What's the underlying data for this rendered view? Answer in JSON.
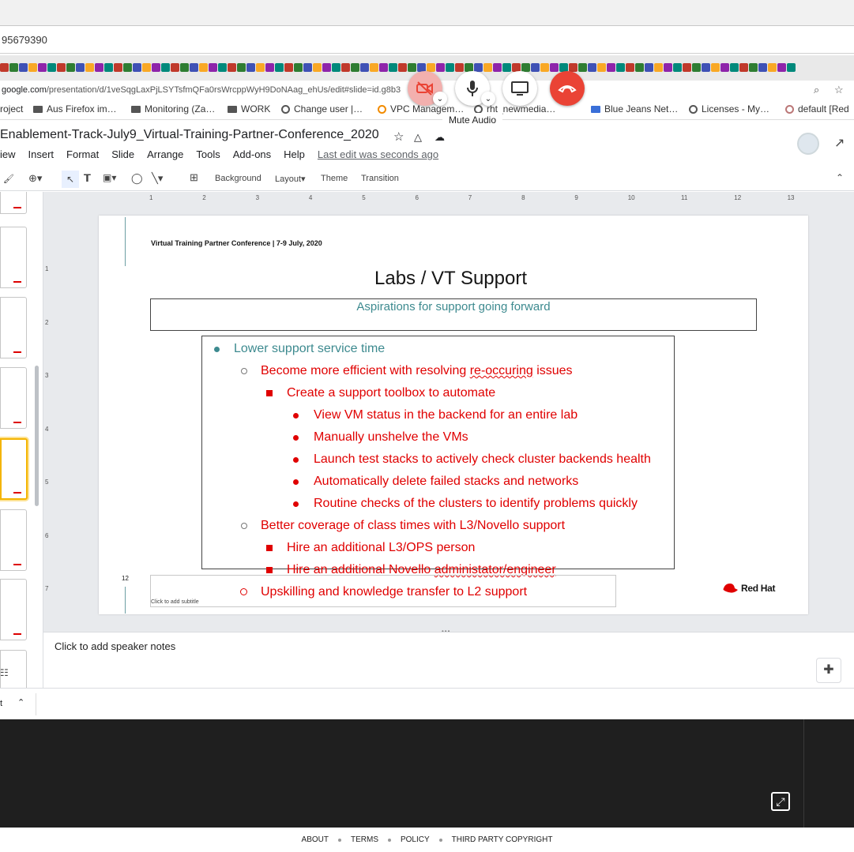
{
  "browser": {
    "url_fragment": "95679390",
    "address": "google.com/presentation/d/1veSqgLaxPjLSYTsfmQFa0rsWrcppWyH9DoNAag_ehUs/edit#slide=id.g8b3",
    "address_host": "google.com",
    "address_path": "/presentation/d/1veSqgLaxPjLSYTsfmQFa0rsWrcppWyH9DoNAag_ehUs/edit#slide=id.g8b3",
    "bookmarks": [
      "roject",
      "Aus Firefox im…",
      "Monitoring (Za…",
      "WORK",
      "Change user |…",
      "VPC Managem…",
      "rht_newmedia…",
      "Blue Jeans Net…",
      "Licenses - My…",
      "default [Red"
    ]
  },
  "call_controls": {
    "tooltip": "Mute Audio",
    "colors": {
      "video_off": "#ea4335",
      "end_call": "#ea4335"
    }
  },
  "docs": {
    "title": "Enablement-Track-July9_Virtual-Training-Partner-Conference_2020",
    "menu": [
      "iew",
      "Insert",
      "Format",
      "Slide",
      "Arrange",
      "Tools",
      "Add-ons",
      "Help"
    ],
    "last_edit": "Last edit was seconds ago",
    "toolbar": {
      "background": "Background",
      "layout": "Layout",
      "theme": "Theme",
      "transition": "Transition"
    },
    "ruler_ticks": [
      "1",
      "2",
      "3",
      "4",
      "5",
      "6",
      "7",
      "8",
      "9",
      "10",
      "11",
      "12",
      "13"
    ],
    "vruler_ticks": [
      "1",
      "2",
      "3",
      "4",
      "5",
      "6",
      "7"
    ]
  },
  "slide": {
    "conference": "Virtual Training Partner Conference | 7-9 July, 2020",
    "title": "Labs / VT Support",
    "subtitle": "Aspirations for support going forward",
    "bullets": {
      "l1": "Lower support service time",
      "l2a": "Become more efficient with resolving ",
      "l2a_misspelled": "re-occuring",
      "l2a_tail": " issues",
      "l3a": "Create a support toolbox to automate",
      "l4": [
        "View VM status in the backend for an entire lab",
        "Manually unshelve the VMs",
        "Launch test stacks to actively check cluster backends health",
        "Automatically delete failed stacks and networks",
        "Routine checks of the clusters to identify problems quickly"
      ],
      "l2b": "Better coverage of class times with L3/Novello support",
      "l3b": "Hire an additional L3/OPS person",
      "l3c_a": "Hire an additional Novello ",
      "l3c_misspelled": "administator/engineer",
      "l2c": "Upskilling and knowledge transfer to L2 support"
    },
    "page_number": "12",
    "subtitle_placeholder": "Click to add subtitle",
    "logo": "Red Hat",
    "colors": {
      "teal": "#3d8a8f",
      "red": "#e00000"
    }
  },
  "notes": {
    "placeholder": "Click to add speaker notes"
  },
  "status": {
    "label": "t"
  },
  "footer": {
    "links": [
      "ABOUT",
      "TERMS",
      "POLICY",
      "THIRD PARTY COPYRIGHT"
    ]
  }
}
